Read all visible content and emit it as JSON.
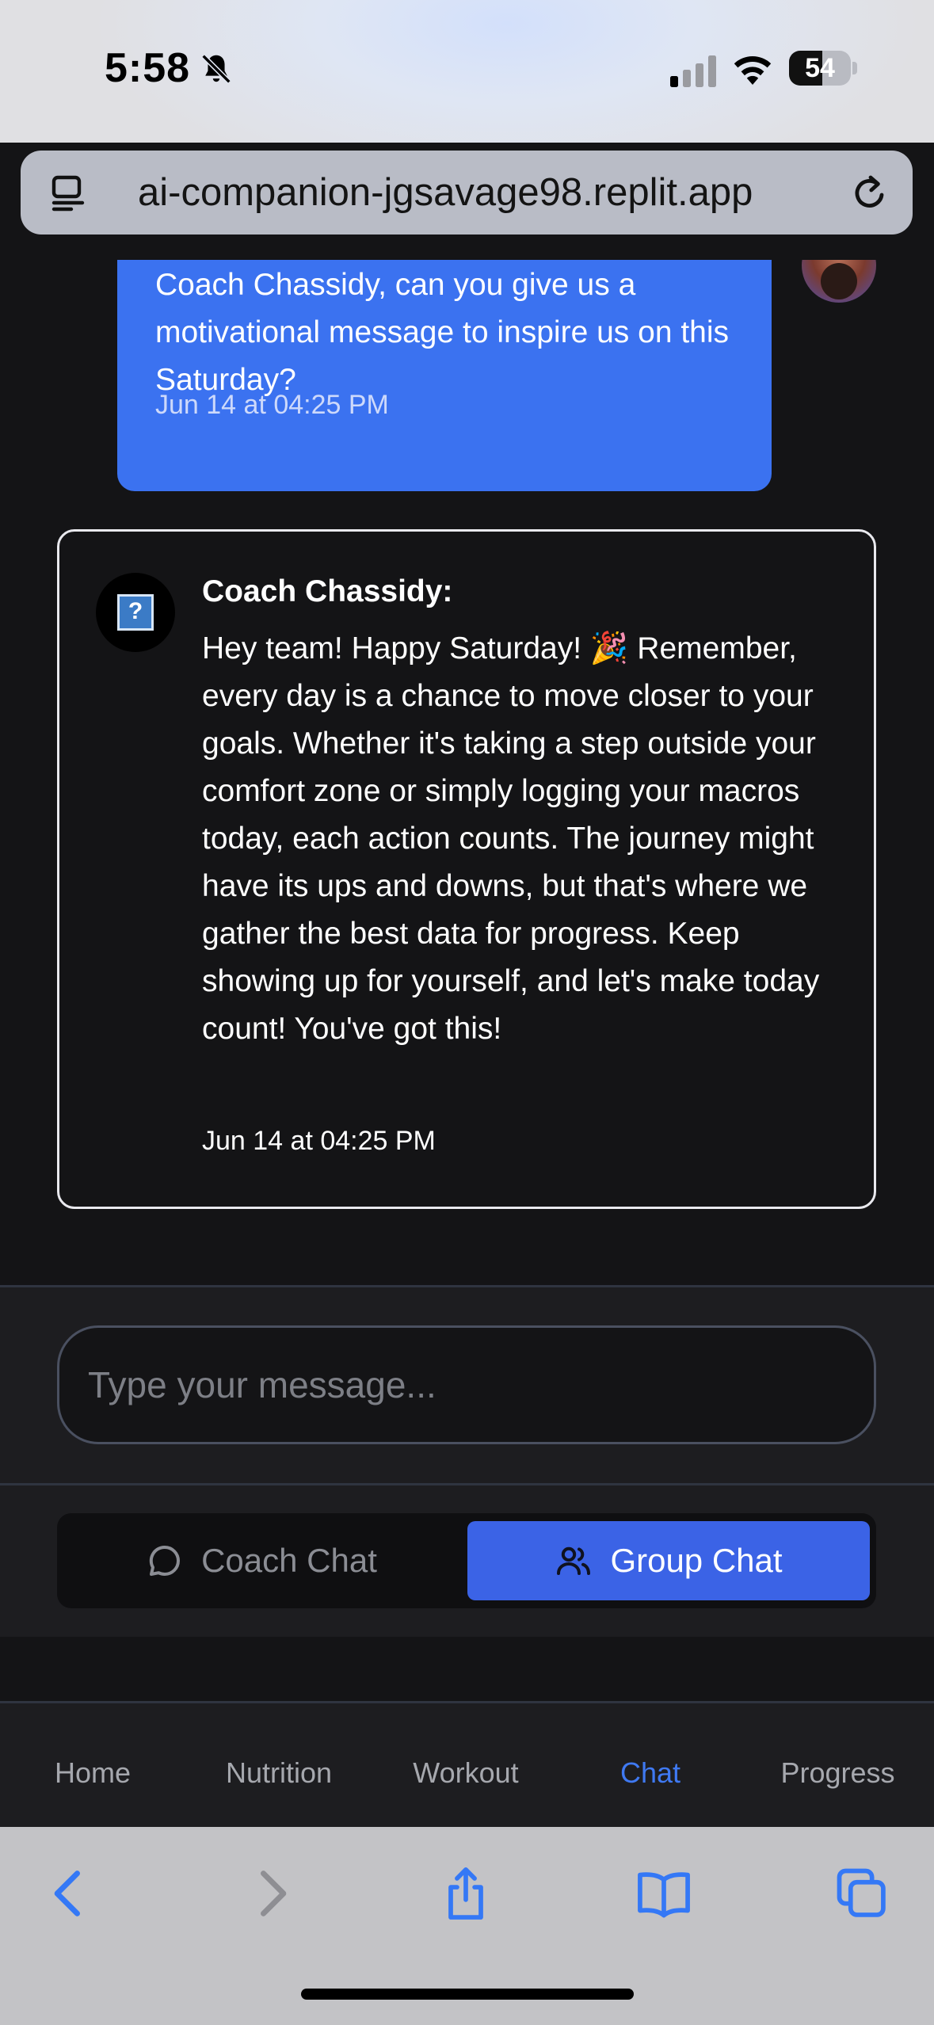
{
  "status_bar": {
    "time": "5:58",
    "battery_level": "54",
    "battery_fraction": 0.54
  },
  "browser": {
    "url": "ai-companion-jgsavage98.replit.app"
  },
  "chat": {
    "user_message": {
      "text": "Coach Chassidy, can you give us a motivational message to inspire us on this Saturday?",
      "timestamp": "Jun 14 at 04:25 PM"
    },
    "coach_message": {
      "sender": "Coach Chassidy:",
      "text": "Hey team! Happy Saturday! 🎉 Remember, every day is a chance to move closer to your goals. Whether it's taking a step outside your comfort zone or simply logging your macros today, each action counts. The journey might have its ups and downs, but that's where we gather the best data for progress. Keep showing up for yourself, and let's make today count! You've got this!",
      "timestamp": "Jun 14 at 04:25 PM",
      "avatar_glyph": "?"
    }
  },
  "composer": {
    "placeholder": "Type your message...",
    "value": ""
  },
  "chat_tabs": {
    "coach": "Coach Chat",
    "group": "Group Chat",
    "active": "group"
  },
  "app_nav": {
    "items": [
      "Home",
      "Nutrition",
      "Workout",
      "Chat",
      "Progress"
    ],
    "active": "Chat"
  },
  "colors": {
    "accent": "#3b63e6",
    "user_bubble": "#3b72f0",
    "nav_active": "#3f79f2",
    "safari_icon": "#3478f6"
  },
  "icons": {
    "status": [
      "bell-slash-icon",
      "cellular-signal-icon",
      "wifi-icon",
      "battery-icon"
    ],
    "browser": [
      "reader-mode-icon",
      "reload-icon"
    ],
    "tabs": [
      "chat-bubble-icon",
      "users-icon"
    ],
    "safari_toolbar": [
      "back-arrow-icon",
      "forward-arrow-icon",
      "share-icon",
      "bookmarks-icon",
      "tabs-icon"
    ]
  }
}
